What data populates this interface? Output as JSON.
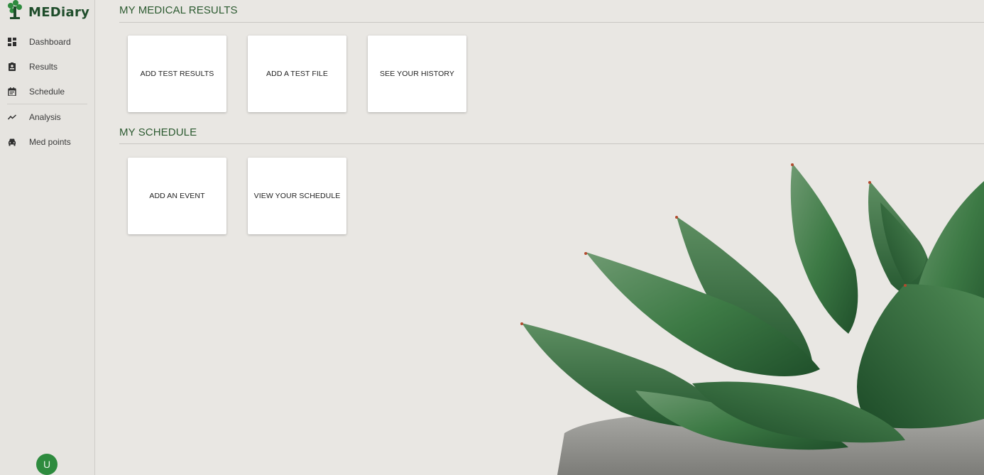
{
  "brand": {
    "name": "MEDiary",
    "accent": "#1f4d2b"
  },
  "sidebar": {
    "items": [
      {
        "label": "Dashboard",
        "icon": "dashboard-icon"
      },
      {
        "label": "Results",
        "icon": "results-badge-icon"
      },
      {
        "label": "Schedule",
        "icon": "calendar-icon"
      },
      {
        "label": "Analysis",
        "icon": "trending-icon"
      },
      {
        "label": "Med points",
        "icon": "car-icon"
      }
    ]
  },
  "user": {
    "initial": "U",
    "avatar_color": "#2e8b3e"
  },
  "sections": {
    "results": {
      "title": "MY MEDICAL RESULTS",
      "cards": [
        "ADD TEST RESULTS",
        "ADD A TEST FILE",
        "SEE YOUR HISTORY"
      ]
    },
    "schedule": {
      "title": "MY SCHEDULE",
      "cards": [
        "ADD AN EVENT",
        "VIEW YOUR SCHEDULE"
      ]
    }
  },
  "background": {
    "image": "succulent-plant-in-concrete-pot"
  }
}
